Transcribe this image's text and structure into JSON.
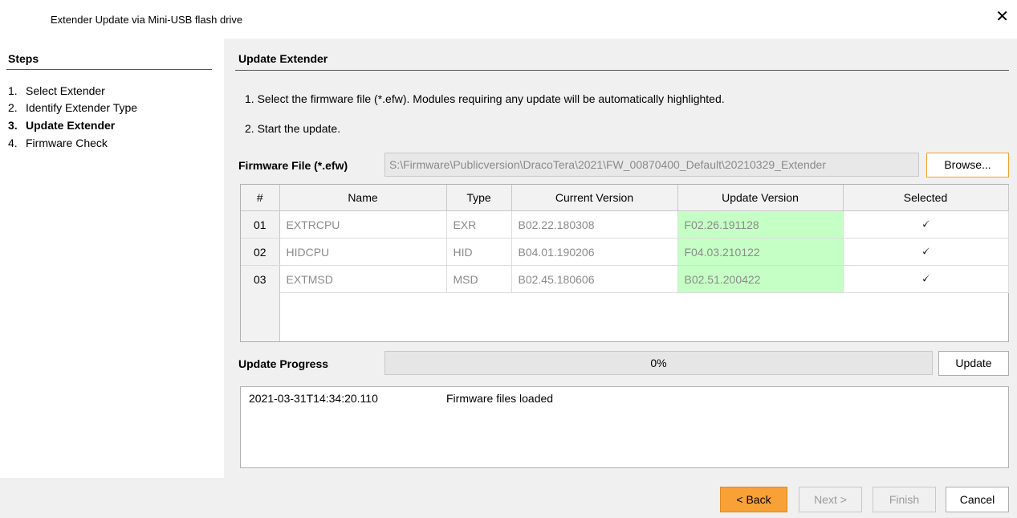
{
  "window": {
    "title": "Extender Update via Mini-USB flash drive",
    "close_glyph": "✕"
  },
  "steps": {
    "title": "Steps",
    "items": [
      {
        "num": "1.",
        "label": "Select Extender"
      },
      {
        "num": "2.",
        "label": "Identify Extender Type"
      },
      {
        "num": "3.",
        "label": "Update Extender",
        "current": true
      },
      {
        "num": "4.",
        "label": "Firmware Check"
      }
    ]
  },
  "main": {
    "title": "Update Extender",
    "instructions": [
      "1.  Select the firmware file (*.efw). Modules requiring any update will be automatically highlighted.",
      "2.  Start the update."
    ],
    "firmware_label": "Firmware File (*.efw)",
    "firmware_path": "S:\\Firmware\\Publicversion\\DracoTera\\2021\\FW_00870400_Default\\20210329_Extender",
    "browse_label": "Browse..."
  },
  "table": {
    "columns": [
      "#",
      "Name",
      "Type",
      "Current Version",
      "Update Version",
      "Selected"
    ],
    "rows": [
      {
        "idx": "01",
        "name": "EXTRCPU",
        "type": "EXR",
        "current": "B02.22.180308",
        "update": "F02.26.191128",
        "selected": true
      },
      {
        "idx": "02",
        "name": "HIDCPU",
        "type": "HID",
        "current": "B04.01.190206",
        "update": "F04.03.210122",
        "selected": true
      },
      {
        "idx": "03",
        "name": "EXTMSD",
        "type": "MSD",
        "current": "B02.45.180606",
        "update": "B02.51.200422",
        "selected": true
      }
    ],
    "highlight_color": "#c6ffc6"
  },
  "progress": {
    "label": "Update Progress",
    "value_text": "0%",
    "value": 0,
    "update_label": "Update"
  },
  "log": {
    "entries": [
      {
        "timestamp": "2021-03-31T14:34:20.110",
        "message": "Firmware files loaded"
      }
    ]
  },
  "footer": {
    "back_label": "< Back",
    "next_label": "Next >",
    "finish_label": "Finish",
    "cancel_label": "Cancel",
    "accent_color": "#f7a137"
  },
  "checkmark_glyph": "🗸"
}
